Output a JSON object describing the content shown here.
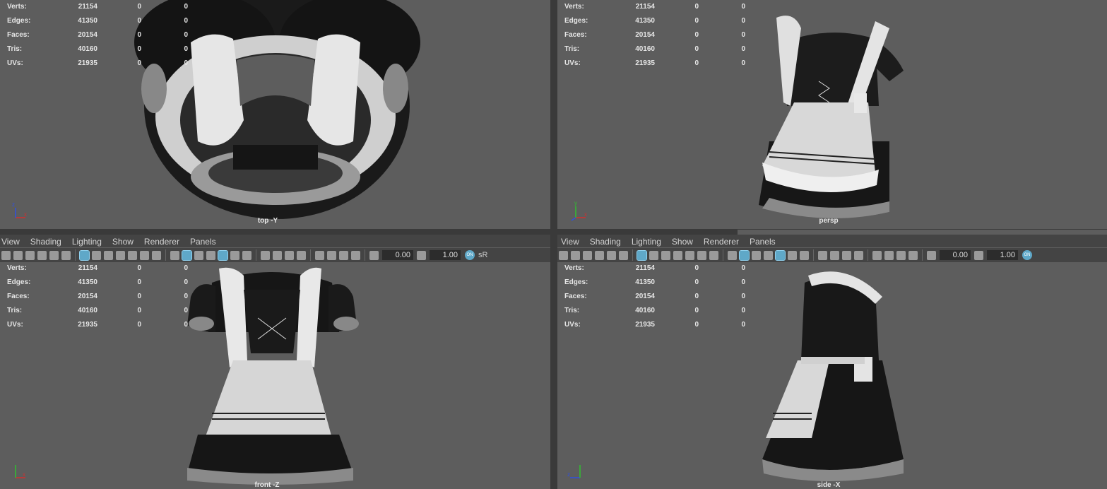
{
  "menu": {
    "items": [
      "View",
      "Shading",
      "Lighting",
      "Show",
      "Renderer",
      "Panels"
    ]
  },
  "stats": {
    "labels": [
      "Verts:",
      "Edges:",
      "Faces:",
      "Tris:",
      "UVs:"
    ],
    "values": [
      [
        "21154",
        "0",
        "0"
      ],
      [
        "41350",
        "0",
        "0"
      ],
      [
        "20154",
        "0",
        "0"
      ],
      [
        "40160",
        "0",
        "0"
      ],
      [
        "21935",
        "0",
        "0"
      ]
    ]
  },
  "viewports": {
    "top": {
      "camera": "top -Y"
    },
    "persp": {
      "camera": "persp"
    },
    "front": {
      "camera": "front -Z"
    },
    "side": {
      "camera": "side -X"
    }
  },
  "toolbar": {
    "exposure": "0.00",
    "gamma": "1.00",
    "colorspace": "sR",
    "on_badge": "ON"
  },
  "colors": {
    "viewport_bg": "#5d5d5d",
    "panel_bar": "#444444",
    "accent": "#5fa8c8",
    "axis_x": "#d03030",
    "axis_y": "#30c030",
    "axis_z": "#3050e0"
  }
}
